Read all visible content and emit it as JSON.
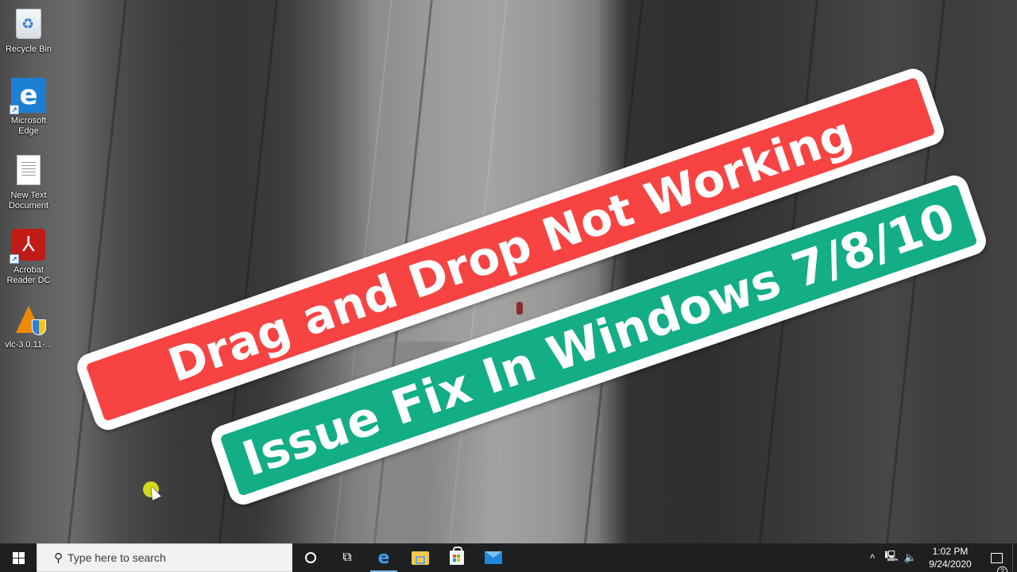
{
  "desktop": {
    "icons": [
      {
        "label": "Recycle Bin",
        "icon": "recycle-bin-icon"
      },
      {
        "label": "Microsoft Edge",
        "icon": "edge-icon"
      },
      {
        "label": "New Text Document",
        "icon": "text-document-icon"
      },
      {
        "label": "Acrobat Reader DC",
        "icon": "acrobat-reader-icon"
      },
      {
        "label": "vlc-3.0.11-...",
        "icon": "vlc-installer-icon"
      }
    ]
  },
  "banners": {
    "top": {
      "text": "Drag and Drop Not Working",
      "color": "#f84343"
    },
    "bottom": {
      "text": "Issue Fix In Windows 7/8/10",
      "color": "#13ad86"
    }
  },
  "taskbar": {
    "start_icon": "windows-logo-icon",
    "search": {
      "placeholder": "Type here to search",
      "value": ""
    },
    "pinned_apps": [
      {
        "name": "Cortana",
        "icon": "cortana-icon"
      },
      {
        "name": "Task View",
        "icon": "task-view-icon"
      },
      {
        "name": "Microsoft Edge",
        "icon": "edge-icon",
        "active": true
      },
      {
        "name": "File Explorer",
        "icon": "folder-icon"
      },
      {
        "name": "Microsoft Store",
        "icon": "store-icon"
      },
      {
        "name": "Mail",
        "icon": "mail-icon"
      }
    ],
    "tray": {
      "chevron": "^",
      "time": "1:02 PM",
      "date": "9/24/2020",
      "notification_count": "2"
    }
  },
  "colors": {
    "taskbar_bg": "#1e1f21",
    "active_indicator": "#76b9ed",
    "banner_border": "#ffffff"
  }
}
